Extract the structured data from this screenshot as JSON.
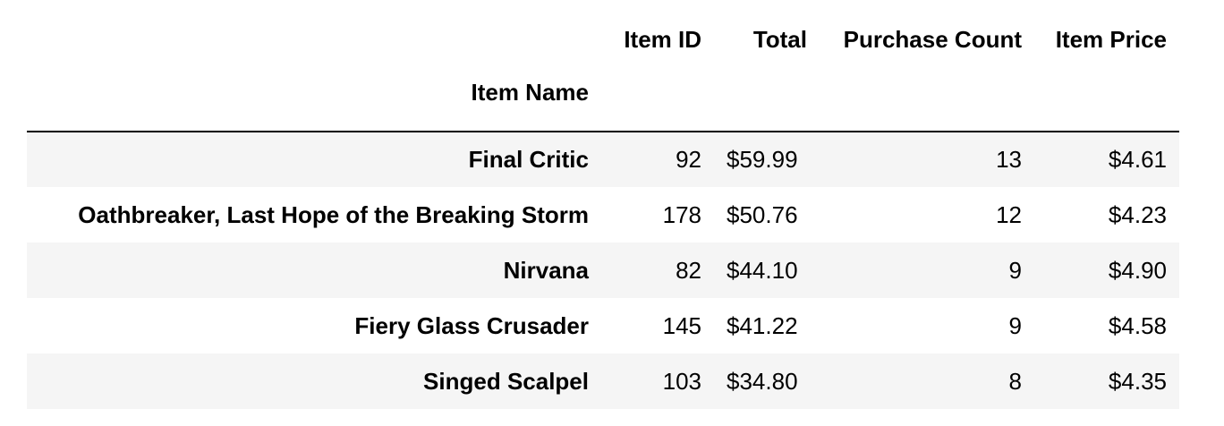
{
  "table": {
    "columns": [
      "Item ID",
      "Total",
      "Purchase Count",
      "Item Price"
    ],
    "index_name": "Item Name",
    "rows": [
      {
        "name": "Final Critic",
        "id": "92",
        "total": "$59.99",
        "count": "13",
        "price": "$4.61"
      },
      {
        "name": "Oathbreaker, Last Hope of the Breaking Storm",
        "id": "178",
        "total": "$50.76",
        "count": "12",
        "price": "$4.23"
      },
      {
        "name": "Nirvana",
        "id": "82",
        "total": "$44.10",
        "count": "9",
        "price": "$4.90"
      },
      {
        "name": "Fiery Glass Crusader",
        "id": "145",
        "total": "$41.22",
        "count": "9",
        "price": "$4.58"
      },
      {
        "name": "Singed Scalpel",
        "id": "103",
        "total": "$34.80",
        "count": "8",
        "price": "$4.35"
      }
    ]
  },
  "colors": {
    "stripe": "#f5f5f5",
    "background": "#ffffff",
    "rule": "#000000"
  }
}
